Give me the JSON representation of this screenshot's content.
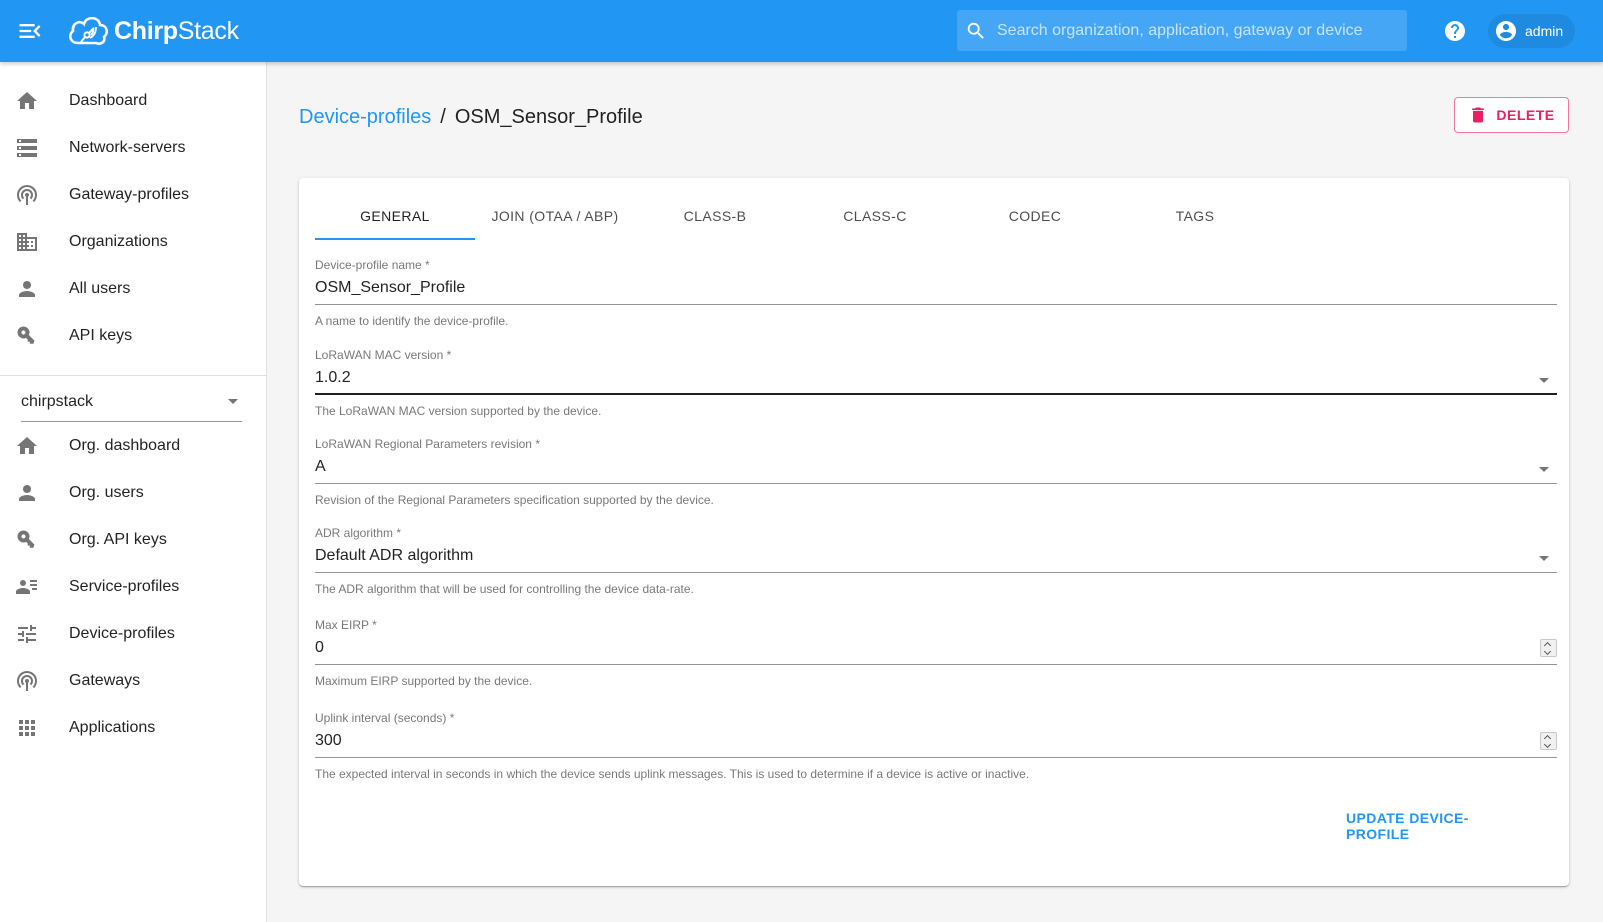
{
  "app": {
    "name_bold": "Chirp",
    "name_light": "Stack",
    "accent_color": "#2196f3",
    "danger_color": "#e91e63"
  },
  "topbar": {
    "search_placeholder": "Search organization, application, gateway or device",
    "user_label": "admin",
    "icons": [
      "menu-back-icon",
      "chirpstack-logo-icon",
      "search-icon",
      "help-icon",
      "account-circle-icon"
    ]
  },
  "sidebar": {
    "admin_items": [
      {
        "label": "Dashboard",
        "icon": "home-icon"
      },
      {
        "label": "Network-servers",
        "icon": "server-icon"
      },
      {
        "label": "Gateway-profiles",
        "icon": "radio-tower-icon"
      },
      {
        "label": "Organizations",
        "icon": "domain-icon"
      },
      {
        "label": "All users",
        "icon": "person-icon"
      },
      {
        "label": "API keys",
        "icon": "key-icon"
      }
    ],
    "org_selector": "chirpstack",
    "org_items": [
      {
        "label": "Org. dashboard",
        "icon": "home-icon"
      },
      {
        "label": "Org. users",
        "icon": "person-icon"
      },
      {
        "label": "Org. API keys",
        "icon": "key-icon"
      },
      {
        "label": "Service-profiles",
        "icon": "account-details-icon"
      },
      {
        "label": "Device-profiles",
        "icon": "tune-icon"
      },
      {
        "label": "Gateways",
        "icon": "radio-tower-icon"
      },
      {
        "label": "Applications",
        "icon": "apps-icon"
      }
    ]
  },
  "page": {
    "breadcrumb_parent": "Device-profiles",
    "breadcrumb_separator": "/",
    "title": "OSM_Sensor_Profile",
    "delete_label": "DELETE"
  },
  "tabs": [
    {
      "label": "GENERAL",
      "active": true
    },
    {
      "label": "JOIN (OTAA / ABP)",
      "active": false
    },
    {
      "label": "CLASS-B",
      "active": false
    },
    {
      "label": "CLASS-C",
      "active": false
    },
    {
      "label": "CODEC",
      "active": false
    },
    {
      "label": "TAGS",
      "active": false
    }
  ],
  "form": {
    "name": {
      "label": "Device-profile name *",
      "value": "OSM_Sensor_Profile",
      "help": "A name to identify the device-profile."
    },
    "mac_version": {
      "label": "LoRaWAN MAC version *",
      "value": "1.0.2",
      "help": "The LoRaWAN MAC version supported by the device."
    },
    "regional_revision": {
      "label": "LoRaWAN Regional Parameters revision *",
      "value": "A",
      "help": "Revision of the Regional Parameters specification supported by the device."
    },
    "adr_algorithm": {
      "label": "ADR algorithm *",
      "value": "Default ADR algorithm",
      "help": "The ADR algorithm that will be used for controlling the device data-rate."
    },
    "max_eirp": {
      "label": "Max EIRP *",
      "value": "0",
      "help": "Maximum EIRP supported by the device."
    },
    "uplink_interval": {
      "label": "Uplink interval (seconds) *",
      "value": "300",
      "help": "The expected interval in seconds in which the device sends uplink messages. This is used to determine if a device is active or inactive."
    },
    "submit_label": "UPDATE DEVICE-PROFILE"
  }
}
